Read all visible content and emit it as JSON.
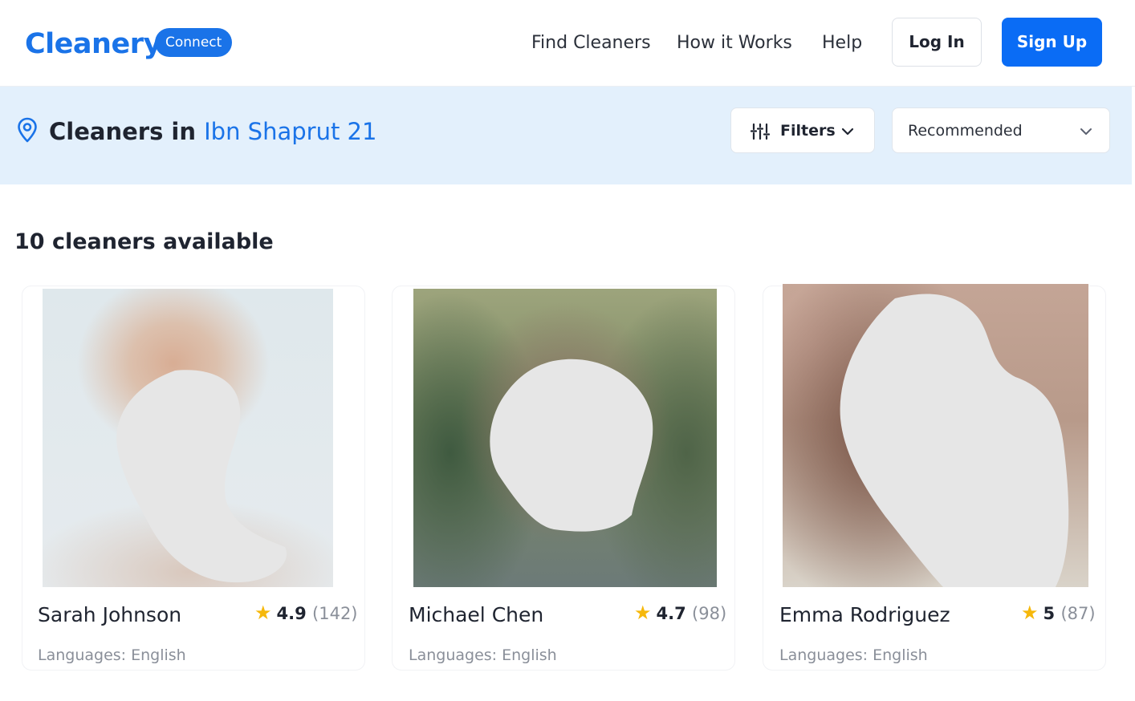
{
  "header": {
    "logo": "Cleanery",
    "badge": "Connect",
    "nav": [
      "Find Cleaners",
      "How it Works",
      "Help"
    ],
    "login_label": "Log In",
    "signup_label": "Sign Up"
  },
  "location_bar": {
    "prefix": "Cleaners in ",
    "place": "Ibn Shaprut 21",
    "filters_label": "Filters",
    "sort_selected": "Recommended"
  },
  "results": {
    "count_text": "10 cleaners available"
  },
  "cleaners": [
    {
      "name": "Sarah Johnson",
      "rating": "4.9",
      "reviews": "(142)",
      "languages": "Languages: English"
    },
    {
      "name": "Michael Chen",
      "rating": "4.7",
      "reviews": "(98)",
      "languages": "Languages: English"
    },
    {
      "name": "Emma Rodriguez",
      "rating": "5",
      "reviews": "(87)",
      "languages": "Languages: English"
    }
  ],
  "colors": {
    "brand": "#1a73e8",
    "primary_button": "#0a6cf5",
    "location_bar_bg": "#e3f0fc",
    "star": "#f6b80b",
    "muted_text": "#8a8f99"
  },
  "icons": {
    "location": "location-pin-icon",
    "filters": "sliders-icon",
    "dropdown": "chevron-down-icon",
    "rating": "star-icon"
  }
}
